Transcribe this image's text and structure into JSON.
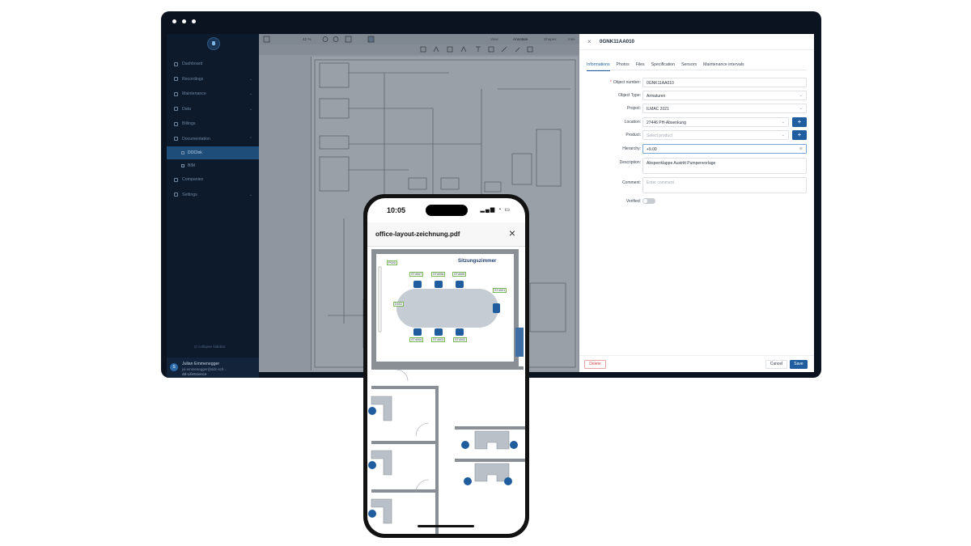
{
  "app": {
    "sidebar": {
      "items": [
        {
          "label": "Dashboard",
          "icon": "home-icon",
          "chevron": false
        },
        {
          "label": "Recordings",
          "icon": "recordings-icon",
          "chevron": true
        },
        {
          "label": "Maintenance",
          "icon": "wrench-icon",
          "chevron": true
        },
        {
          "label": "Data",
          "icon": "document-icon",
          "chevron": true
        },
        {
          "label": "Billings",
          "icon": "billing-icon",
          "chevron": false
        },
        {
          "label": "Documentation",
          "icon": "book-icon",
          "chevron": true
        }
      ],
      "sub_items": [
        {
          "label": "DOCInk",
          "active": true
        },
        {
          "label": "BIM",
          "active": false
        }
      ],
      "items_after": [
        {
          "label": "Companies",
          "icon": "building-icon"
        },
        {
          "label": "Settings",
          "icon": "gear-icon"
        }
      ],
      "collapse_label": "collapse sidebar",
      "user": {
        "initial": "S",
        "name": "Julian Emmenegger",
        "email": "jul.emmenegger@ddc-sch...",
        "company": "dd-LifeScience"
      }
    },
    "toolbar": {
      "zoom": "42 %",
      "tabs": [
        "View",
        "Annotate",
        "Shapes",
        "Inse"
      ]
    },
    "panel": {
      "title": "0GNK11AA010",
      "tabs": [
        "Informations",
        "Photos",
        "Files",
        "Specification",
        "Sensors",
        "Maintenance intervals"
      ],
      "active_tab": "Informations",
      "fields": {
        "object_number": {
          "label": "Object number:",
          "value": "0GNK11AA010",
          "required": true
        },
        "object_type": {
          "label": "Object Type:",
          "value": "Armaturen"
        },
        "project": {
          "label": "Project:",
          "value": "ILMAC 2021"
        },
        "location": {
          "label": "Location:",
          "value": "27446 PH-Absenkung"
        },
        "product": {
          "label": "Product:",
          "placeholder": "Select product"
        },
        "hierarchy": {
          "label": "Hierarchy:",
          "value": "+9.00"
        },
        "description": {
          "label": "Description:",
          "value": "Absperrklappe Austritt Pumpenvorlage"
        },
        "comment": {
          "label": "Comment:",
          "placeholder": "Enter comment"
        },
        "verified": {
          "label": "Verified:",
          "on": false
        }
      },
      "buttons": {
        "delete": "Delete",
        "cancel": "Cancel",
        "save": "Save"
      }
    }
  },
  "phone": {
    "time": "10:05",
    "document_title": "office-layout-zeichnung.pdf",
    "room_label": "Sitzungszimmer",
    "markers": [
      "P000",
      "ST4007",
      "ST4006",
      "ST4005",
      "ST4001",
      "D002",
      "ST4004",
      "ST4003",
      "ST4002"
    ]
  }
}
